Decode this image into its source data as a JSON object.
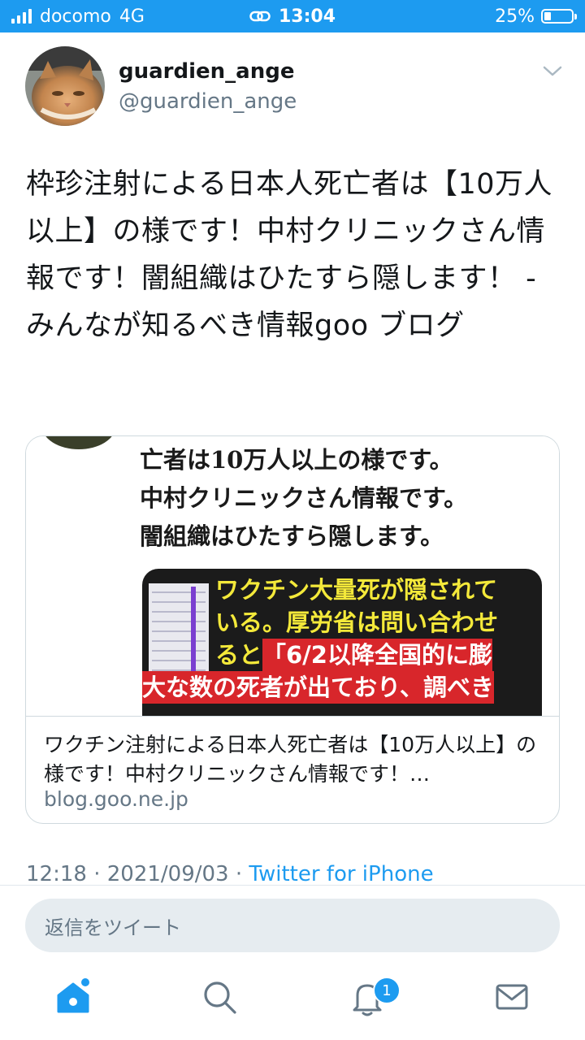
{
  "status_bar": {
    "carrier": "docomo",
    "network": "4G",
    "time": "13:04",
    "battery": "25%",
    "battery_level": 0.25
  },
  "tweet": {
    "display_name": "guardien_ange",
    "handle": "@guardien_ange",
    "text": "枠珍注射による日本人死亡者は【10万人以上】の様です！中村クリニックさん情報です！闇組織はひたすら隠します！ - みんなが知るべき情報goo ブログ",
    "card": {
      "media_headline": [
        "亡者は10万人以上の様です。",
        "中村クリニックさん情報です。",
        "闇組織はひたすら隠します。"
      ],
      "media_text": [
        "ワクチン大量死が隠されて",
        "いる。厚労省は問い合わせ",
        "ると",
        "「6/2以降全国的に膨",
        "大な数の死者が出ており、調べき"
      ],
      "title": "ワクチン注射による日本人死亡者は【10万人以上】の様です！中村クリニックさん情報です！…",
      "domain": "blog.goo.ne.jp"
    },
    "meta": {
      "time": "12:18",
      "separator": "·",
      "date": "2021/09/03",
      "source": "Twitter for iPhone"
    }
  },
  "reply": {
    "placeholder": "返信をツイート"
  },
  "tab_bar": {
    "notifications_badge": "1"
  },
  "colors": {
    "accent": "#1d9bf0",
    "text_primary": "#14171a",
    "text_secondary": "#657786",
    "border": "#cfd9de"
  }
}
